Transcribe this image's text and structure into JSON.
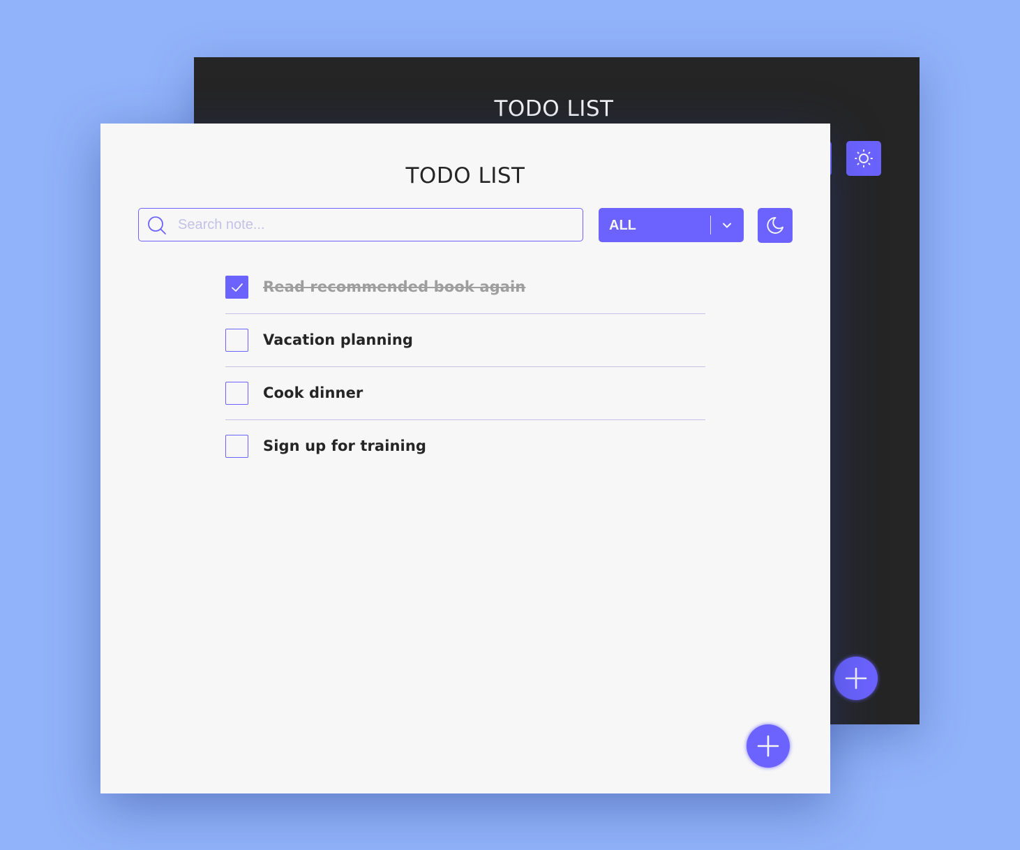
{
  "colors": {
    "accent": "#6c63ff",
    "background": "#91b3fa",
    "light_surface": "#f7f7f7",
    "dark_surface": "#252525",
    "divider": "#c3c1e5",
    "completed_text": "#9e9e9e"
  },
  "dark_window": {
    "title": "TODO LIST",
    "theme_toggle_icon": "sun-icon",
    "add_button_icon": "plus-icon"
  },
  "light_window": {
    "title": "TODO LIST",
    "search": {
      "placeholder": "Search note...",
      "value": "",
      "icon": "search-icon"
    },
    "filter": {
      "selected": "ALL",
      "icon": "chevron-down-icon"
    },
    "theme_toggle_icon": "moon-icon",
    "todos": [
      {
        "text": "Read recommended book again",
        "completed": true
      },
      {
        "text": "Vacation planning",
        "completed": false
      },
      {
        "text": "Cook dinner",
        "completed": false
      },
      {
        "text": "Sign up for training",
        "completed": false
      }
    ],
    "add_button_icon": "plus-icon"
  }
}
